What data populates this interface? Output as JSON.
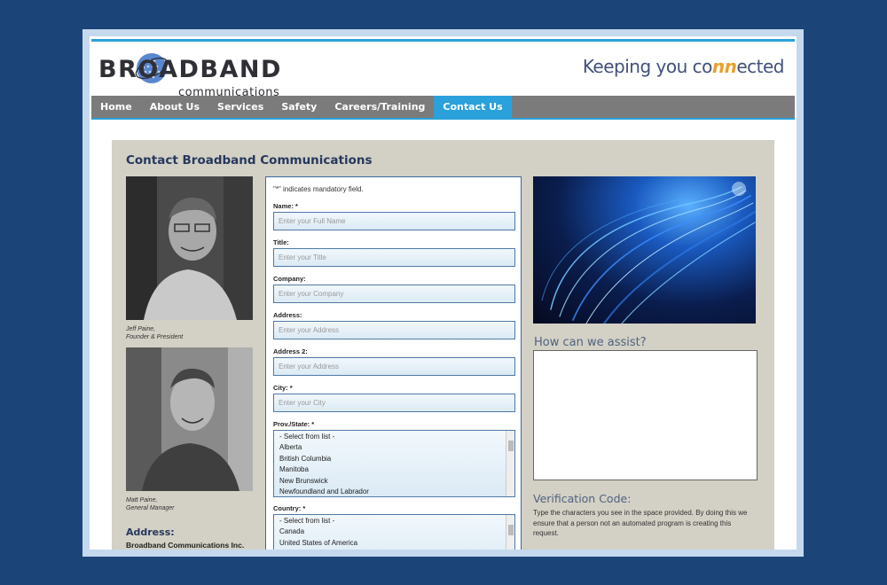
{
  "brand": {
    "logo_word": "BROADBAND",
    "logo_sub": "communications",
    "tagline_pre": "Keeping you co",
    "tagline_accent": "nn",
    "tagline_post": "ected",
    "accent_color": "#2aa1da",
    "tagline_accent_color": "#e8a02a"
  },
  "nav": {
    "items": [
      "Home",
      "About Us",
      "Services",
      "Safety",
      "Careers/Training",
      "Contact Us"
    ],
    "active": "Contact Us"
  },
  "content": {
    "heading": "Contact Broadband Communications",
    "staff": [
      {
        "name": "Jeff Paine,",
        "title": "Founder & President"
      },
      {
        "name": "Matt Paine,",
        "title": "General Manager"
      }
    ],
    "address_heading": "Address:",
    "address_company": "Broadband Communications Inc."
  },
  "form": {
    "note": "\"*\" indicates mandatory field.",
    "fields": [
      {
        "label": "Name: *",
        "placeholder": "Enter your Full Name"
      },
      {
        "label": "Title:",
        "placeholder": "Enter your Title"
      },
      {
        "label": "Company:",
        "placeholder": "Enter your Company"
      },
      {
        "label": "Address:",
        "placeholder": "Enter your Address"
      },
      {
        "label": "Address 2:",
        "placeholder": "Enter your Address"
      },
      {
        "label": "City: *",
        "placeholder": "Enter your City"
      }
    ],
    "province_label": "Prov./State: *",
    "province_options": [
      "- Select from list -",
      "Alberta",
      "British Columbia",
      "Manitoba",
      "New Brunswick",
      "Newfoundland and Labrador"
    ],
    "country_label": "Country: *",
    "country_options": [
      "- Select from list -",
      "Canada",
      "United States of America"
    ]
  },
  "right": {
    "assist_heading": "How can we assist?",
    "verification_heading": "Verification Code:",
    "verification_text": "Type the characters you see in the space provided.  By doing this we ensure that a person not an automated program is creating this request."
  }
}
